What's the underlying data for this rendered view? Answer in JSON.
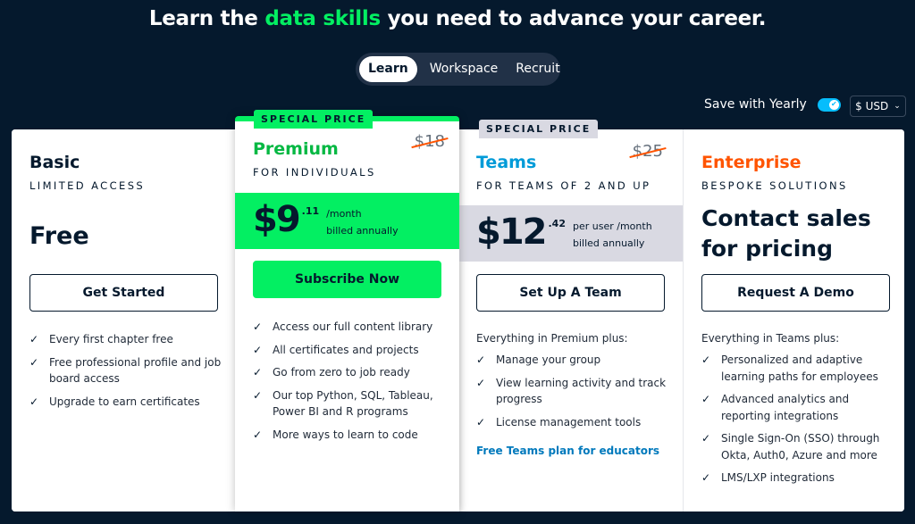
{
  "headline": {
    "before": "Learn the ",
    "accent": "data skills",
    "after": " you need to advance your career."
  },
  "product_switch": {
    "tabs": [
      {
        "label": "Learn",
        "active": true
      },
      {
        "label": "Workspace",
        "active": false
      },
      {
        "label": "Recruit",
        "active": false
      }
    ]
  },
  "billing": {
    "yearly_label": "Save with Yearly",
    "yearly_enabled": true,
    "toggle_icon": "check-icon",
    "currency": "$ USD"
  },
  "colors": {
    "background": "#05192d",
    "brand_green": "#03ef62",
    "premium_title": "#05b843",
    "teams_blue": "#009bd8",
    "enterprise_orange": "#ff5400",
    "teams_band": "#d9d9e2"
  },
  "plans": {
    "basic": {
      "name": "Basic",
      "subtitle": "LIMITED ACCESS",
      "price": "Free",
      "cta": "Get Started",
      "features": [
        "Every first chapter free",
        "Free professional profile and job board access",
        "Upgrade to earn certificates"
      ]
    },
    "premium": {
      "badge": "SPECIAL PRICE",
      "name": "Premium",
      "subtitle": "FOR INDIVIDUALS",
      "old_price": "$18",
      "price_whole": "$9",
      "price_cents": ".11",
      "price_unit": "/month",
      "price_note": "billed annually",
      "cta": "Subscribe Now",
      "features": [
        "Access our full content library",
        "All certificates and projects",
        "Go from zero to job ready",
        "Our top Python, SQL, Tableau, Power BI and R programs",
        "More ways to learn to code"
      ]
    },
    "teams": {
      "badge": "SPECIAL PRICE",
      "name": "Teams",
      "subtitle": "FOR TEAMS OF 2 AND UP",
      "old_price": "$25",
      "price_whole": "$12",
      "price_cents": ".42",
      "price_unit": "per user /month",
      "price_note": "billed annually",
      "cta": "Set Up A Team",
      "lead": "Everything in Premium plus:",
      "features": [
        "Manage your group",
        "View learning activity and track progress",
        "License management tools"
      ],
      "link": "Free Teams plan for educators"
    },
    "enterprise": {
      "name": "Enterprise",
      "subtitle": "BESPOKE SOLUTIONS",
      "price": "Contact sales for pricing",
      "cta": "Request A Demo",
      "lead": "Everything in Teams plus:",
      "features": [
        "Personalized and adaptive learning paths for employees",
        "Advanced analytics and reporting integrations",
        "Single Sign-On (SSO) through Okta, Auth0, Azure and more",
        "LMS/LXP integrations"
      ]
    }
  },
  "icons": {
    "check": "✓",
    "chevron": "⌄",
    "toggle_check": "✔"
  }
}
